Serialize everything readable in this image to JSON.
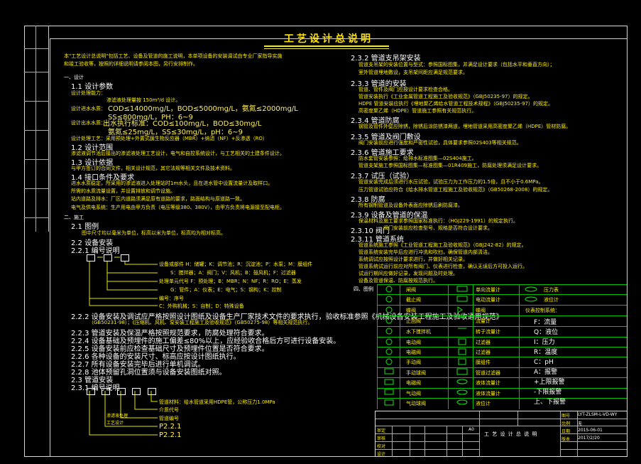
{
  "title": "工艺设计总说明",
  "left": {
    "intro1": "本\"工艺设计总说明\"包括工艺、设备及管道的施工说明，本单项设备的安装调试由专业厂家指导实施",
    "intro2": "和竣工验收等，按照的详细说明请参阅本图，另行安排制作。",
    "s1": "一、设计",
    "s11": "1.1 设计参数",
    "s11a": "设计处理能力：",
    "s11b": "渗滤液处理量按 150m³/d 设计。",
    "s11c_label": "设计进水水质：",
    "s11c": "COD≤14000mg/L，BOD≤5000mg/L，氨氮≤2000mg/L",
    "s11d": "SS≤800mg/L，PH：6~9",
    "s11e_label": "设计出水水质：",
    "s11e": "出水执行标准：COD≤100mg/L，BOD≤30mg/L",
    "s11f": "氨氮≤25mg/L，SS≤30mg/L，pH：6~9",
    "s11g": "设计处理工艺：采用预处理+外置式膜生物反应器（MBR）+纳滤（NF）+反渗透（RO）",
    "s12": "1.2 设计范围",
    "s12a": "渗滤液调节池后接出的渗滤液处理工艺设计，电气和自控系统设计，与工艺相关的土建条件设计。",
    "s13": "1.3 设计依据",
    "s13a": "与甲方签订的合同文件，相关设计规范，其它法规等相关文件及技术资料。",
    "s14": "1.4 接口条件及要求",
    "s14a": "进水水质稳定，所采用的渗滤液进入处理站时1m水头，且在进水管中设置流量计及取样口。",
    "s14b": "所需的水质流量设置，并设置排放和调节设施。",
    "s14c": "站内道路及排水：厂区内道路须满足原有道路的要求，路面结构与原道路一致。",
    "s14d": "电气及供电系统：生产用电由甲方负责（电压等级380、380V），由甲方负责将电源接至配电柜。",
    "s2": "二、施工",
    "s21": "2.1 图例",
    "s21a": "图中尺寸均以毫米为单位，标高以米为单位，标高均为相对标高。",
    "s22": "2.2 设备安装",
    "s221": "2.2.1 编号说明",
    "s22_items": [
      "设备或部件 H：储罐；K：调节池；R：沉淀池；P：水泵；M：膜组件",
      "S：搅拌器；A：阀门；V：风机；B：鼓风机；F：过滤器",
      "处理单元代号 F：预处理；B：MBR；N：NF；R：RO；E：蒸发",
      "G：管件；A：仪表；E：电气；S：钢构；K：控制",
      "编号：序号",
      "C：外购机械；S：自制；D：特殊设备"
    ],
    "s222": "2.2.2 设备安装及调试应严格按照设计图纸及设备生产厂家技术文件的要求执行，验收标准参照《机械设备安装工程施工及验收通用规范》",
    "s222b": "（GB50231-98）；《压缩机、风机、泵安装工程施工及验收规范》（GB50275-98）等相关规范执行。",
    "s223": "2.2.3 管道安装及保温严格按照规范要求，防腐处理符合要求。",
    "s224": "2.2.4 设备基础及预埋件的施工偏差≤80%以上，应经验收合格后方可进行设备安装。",
    "s225": "2.2.5 设备安装前应检查基础尺寸及预埋件位置是否符合要求。",
    "s226": "2.2.6 各种设备的安装尺寸、标高应按设计图纸执行。",
    "s227": "2.2.7 所有设备安装完毕后进行单机调试。",
    "s228": "2.2.8 池体预留孔洞位置须与设备安装图纸对照。",
    "s23": "2.3 管道安装",
    "s231": "2.3.1 编号说明",
    "s23_items": [
      "管道材料：给水管道采用HDPE管，公称压力1.0MPa",
      "介质代号",
      "管道编号",
      "P2.2.1",
      "P2.2.1"
    ]
  },
  "right": {
    "s232": "2.3.2 管道支吊架安装",
    "s232a": "管道支吊架的安装位置与型式：参照国标图集，并满足设计要求（包括水平和垂直方向）；",
    "s232b": "室外管道埋地敷设，支吊架间距应满足规范要求。",
    "s233": "2.3.3 管道的安装",
    "s233a": "管道、管件及阀门应按设计要求检查合格。",
    "s233b": "管道安装执行《工业金属管道工程施工及验收规范》（GBJ50235-97）的规定。",
    "s233c": "HDPE 管道安装应执行《埋地聚乙烯给水管道工程技术规程》（GBJ50235-97）的规定。",
    "s233d": "高密度聚乙烯（HDPE）管道施工参照有关规范执行。",
    "s234": "2.3.4 管道防腐",
    "s234a": "钢管及管件外壁应除锈，除锈后涂防锈漆两道，埋地管道采用高密度聚乙烯（HDPE）管材防腐。",
    "s235": "2.3.5 管道及阀门敷设",
    "s235a": "阀门安装前应进行强度和严密性试验，具体要求参照02S403等相关规范。",
    "s236": "2.3.6 管道施工要求",
    "s236a": "防水套管安装参照：给排水标准图集—02S404施工。",
    "s236b": "管道支架施工参照国标图集—标准图集—01R409施工，防腐处理须满足设计要求。",
    "s237": "2.3.7 试压（试验）",
    "s237a": "管道安装完成后须进行水压试验，试验压力为工作压力的1.5倍，且不小于0.6MPa。",
    "s237b": "压力管道试验应符合《给水排水管道工程施工及验收规范》（GB50268-2008）的规定。",
    "s238": "2.3.8 防腐",
    "s238a": "所有钢制管道及设备外表面应除锈后刷防腐漆。",
    "s239": "2.3.9 设备及管道的保温",
    "s239a": "保温材料及施工要求参照国家标准执行：（HGJ229-1991）的规定执行。",
    "s2310": "2.3.10 阀门",
    "s2310a": "阀门安装前应检查型号、规格是否符合设计要求。",
    "s2311": "2.3.11 管道系统",
    "s2311a": "管道系统施工参照《工业管道工程施工及验收规范》（GBJ242-82）的规定。",
    "s2311b": "管道系统安装完毕后应进行冲洗和吹扫，确保管道内部清洁。",
    "s2311c": "系统调试应按照设计要求进行，并做好相关记录。",
    "s2311d": "管道系统试运行前应对所有阀门、仪表进行检查，确认无误后方可投入运行。",
    "s2311e": "试运行期间应做好记录，发现问题及时处理。",
    "s2311f": "设备及管道保温、防腐按规范执行。",
    "legend_label": "四、图例"
  },
  "legend": {
    "col1": [
      "闸阀",
      "截止阀",
      "蝶阀",
      "止回阀",
      "水下搅拌机",
      "电动阀",
      "电磁阀",
      "手动阀",
      "手动球阀",
      "电磁阀",
      "气动阀",
      "气动球阀"
    ],
    "col2": [
      "单向流量计",
      "电动流量计",
      "蝶阀",
      "流量计",
      "转子流量计",
      "过滤器",
      "过滤器",
      "膜组件",
      "管道过滤器",
      "液体流量计",
      "液体流量计",
      "液位计"
    ],
    "col3": [
      "压力表",
      "液位计",
      "仪表控制系统："
    ],
    "col3_items": [
      "F：流量",
      "Q：液位",
      "I：压力",
      "R：温度",
      "C：pH",
      "A：报警",
      "+上限报警",
      "-下限报警",
      "上、下报警"
    ]
  },
  "titleblock": {
    "project": "渗滤液处理",
    "subtitle": "工艺设计",
    "drawing_title": "工 艺 设 计 总 说 明",
    "drawing_no": "LYT-ZLSM-L-VD-WY",
    "scale": "无",
    "date": "2015-06-01",
    "rev": "2017/2/20",
    "labels": [
      "审定",
      "审核",
      "校对",
      "设计",
      "制图",
      "图号",
      "比例",
      "日期",
      "版本"
    ],
    "mark": "A0"
  }
}
